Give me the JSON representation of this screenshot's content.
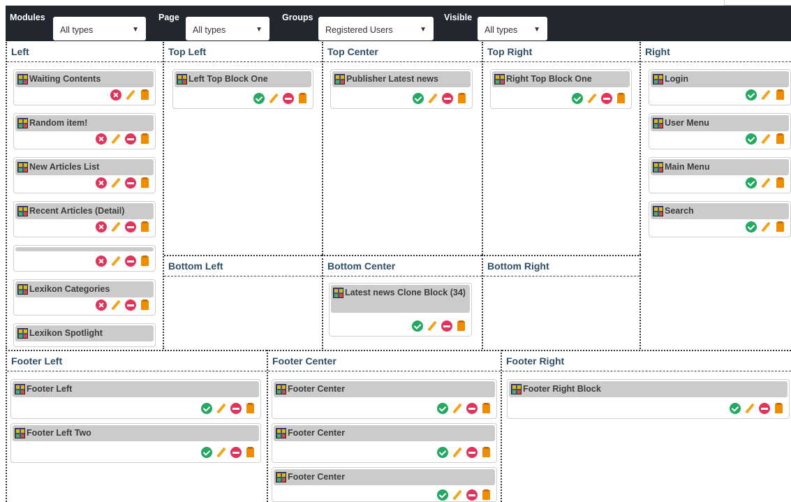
{
  "filters": {
    "modules": {
      "label": "Modules",
      "value": "All types"
    },
    "page": {
      "label": "Page",
      "value": "All types"
    },
    "groups": {
      "label": "Groups",
      "value": "Registered Users"
    },
    "visible": {
      "label": "Visible",
      "value": "All types"
    }
  },
  "zones": {
    "left": {
      "title": "Left",
      "blocks": [
        {
          "title": "Waiting Contents",
          "actions": [
            "disabled-icon",
            "edit-icon",
            "delete-icon"
          ]
        },
        {
          "title": "Random item!",
          "actions": [
            "disabled-icon",
            "edit-icon",
            "remove-icon",
            "clone-icon"
          ]
        },
        {
          "title": "New Articles List",
          "actions": [
            "disabled-icon",
            "edit-icon",
            "remove-icon",
            "clone-icon"
          ]
        },
        {
          "title": "Recent Articles (Detail)",
          "actions": [
            "disabled-icon",
            "edit-icon",
            "remove-icon",
            "clone-icon"
          ]
        },
        {
          "title": "",
          "actions": [
            "disabled-icon",
            "edit-icon",
            "remove-icon",
            "clone-icon"
          ]
        },
        {
          "title": "Lexikon Categories",
          "actions": [
            "disabled-icon",
            "edit-icon",
            "remove-icon",
            "clone-icon"
          ]
        },
        {
          "title": "Lexikon Spotlight",
          "actions": []
        }
      ]
    },
    "top_left": {
      "title": "Top Left",
      "blocks": [
        {
          "title": "Left Top Block One"
        }
      ]
    },
    "top_center": {
      "title": "Top Center",
      "blocks": [
        {
          "title": "Publisher Latest news"
        }
      ]
    },
    "top_right": {
      "title": "Top Right",
      "blocks": [
        {
          "title": "Right Top Block One"
        }
      ]
    },
    "right": {
      "title": "Right",
      "blocks": [
        {
          "title": "Login"
        },
        {
          "title": "User Menu"
        },
        {
          "title": "Main Menu"
        },
        {
          "title": "Search"
        }
      ]
    },
    "bottom_left": {
      "title": "Bottom Left"
    },
    "bottom_center": {
      "title": "Bottom Center",
      "blocks": [
        {
          "title": "Latest news Clone Block (34)"
        }
      ]
    },
    "bottom_right": {
      "title": "Bottom Right"
    },
    "footer_left": {
      "title": "Footer Left",
      "blocks": [
        {
          "title": "Footer Left"
        },
        {
          "title": "Footer Left Two"
        }
      ]
    },
    "footer_center": {
      "title": "Footer Center",
      "blocks": [
        {
          "title": "Footer Center"
        },
        {
          "title": "Footer Center"
        },
        {
          "title": "Footer Center"
        }
      ]
    },
    "footer_right": {
      "title": "Footer Right",
      "blocks": [
        {
          "title": "Footer Right Block"
        }
      ]
    }
  },
  "colors": {
    "bar": "#22262e",
    "zone_title": "#2f4f66",
    "enabled": "#24a862",
    "disabled": "#e0345a",
    "edit": "#f2a31c",
    "clone": "#f08c00"
  }
}
